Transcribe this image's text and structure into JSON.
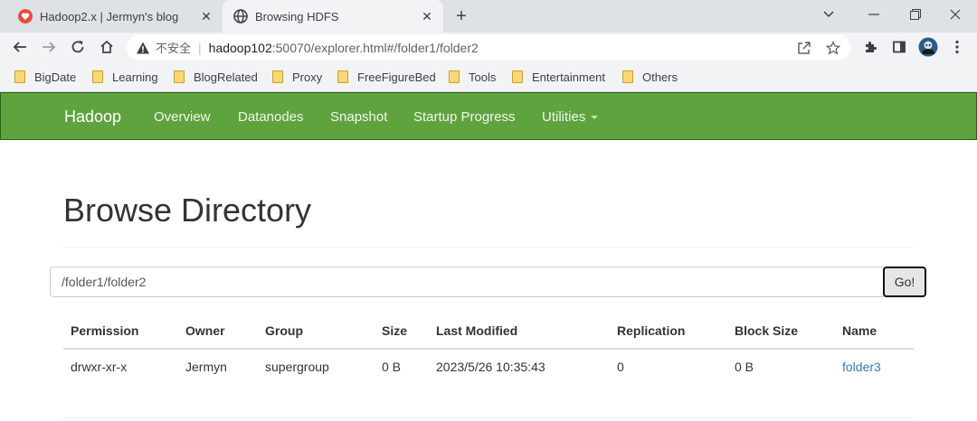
{
  "tabs": [
    {
      "title": "Hadoop2.x | Jermyn's blog",
      "favicon": "heart-icon",
      "color": "#e74c3c"
    },
    {
      "title": "Browsing HDFS",
      "favicon": "globe-icon"
    }
  ],
  "address_bar": {
    "security_label": "不安全",
    "separator": "|",
    "url_host": "hadoop102",
    "url_rest": ":50070/explorer.html#/folder1/folder2"
  },
  "bookmarks": [
    "BigDate",
    "Learning",
    "BlogRelated",
    "Proxy",
    "FreeFigureBed",
    "Tools",
    "Entertainment",
    "Others"
  ],
  "navbar": {
    "brand": "Hadoop",
    "items": [
      "Overview",
      "Datanodes",
      "Snapshot",
      "Startup Progress",
      "Utilities"
    ],
    "color": "#5fa33e"
  },
  "page": {
    "title": "Browse Directory",
    "path_value": "/folder1/folder2",
    "go_label": "Go!"
  },
  "table": {
    "headers": [
      "Permission",
      "Owner",
      "Group",
      "Size",
      "Last Modified",
      "Replication",
      "Block Size",
      "Name"
    ],
    "rows": [
      [
        "drwxr-xr-x",
        "Jermyn",
        "supergroup",
        "0 B",
        "2023/5/26 10:35:43",
        "0",
        "0 B",
        "folder3"
      ]
    ]
  }
}
